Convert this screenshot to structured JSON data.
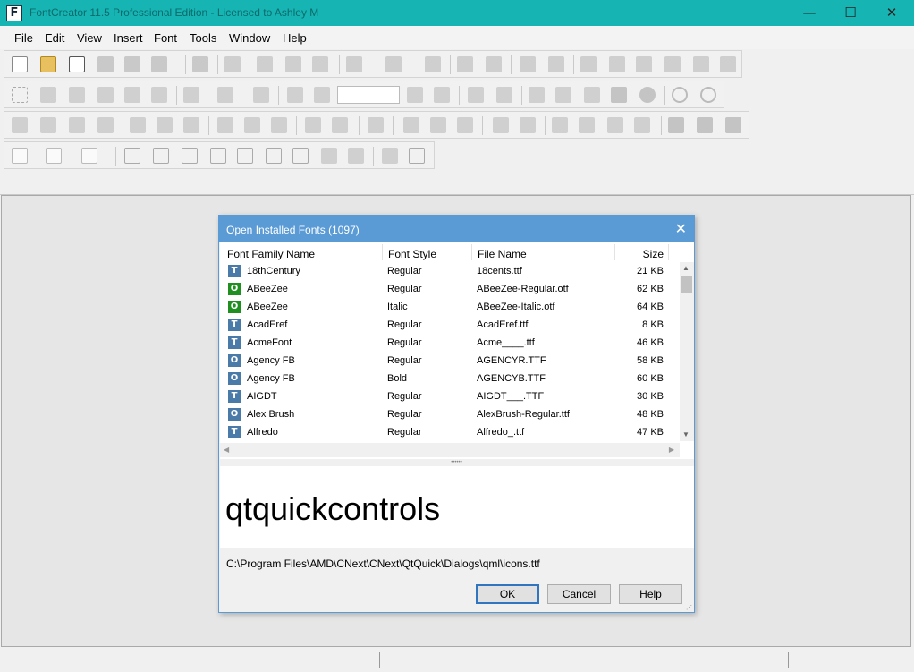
{
  "window": {
    "title": "FontCreator 11.5 Professional Edition - Licensed to Ashley M",
    "min_glyph": "—",
    "max_glyph": "☐",
    "close_glyph": "✕"
  },
  "menubar": {
    "items": [
      "File",
      "Edit",
      "View",
      "Insert",
      "Font",
      "Tools",
      "Window",
      "Help"
    ]
  },
  "toolbar": {
    "zoom_value": ""
  },
  "dialog": {
    "title": "Open Installed Fonts (1097)",
    "close_glyph": "✕",
    "columns": [
      "Font Family Name",
      "Font Style",
      "File Name",
      "Size"
    ],
    "rows": [
      {
        "type": "T",
        "name": "18thCentury",
        "style": "Regular",
        "file": "18cents.ttf",
        "size": "21 KB"
      },
      {
        "type": "O",
        "name": "ABeeZee",
        "style": "Regular",
        "file": "ABeeZee-Regular.otf",
        "size": "62 KB"
      },
      {
        "type": "O",
        "name": "ABeeZee",
        "style": "Italic",
        "file": "ABeeZee-Italic.otf",
        "size": "64 KB"
      },
      {
        "type": "T",
        "name": "AcadEref",
        "style": "Regular",
        "file": "AcadEref.ttf",
        "size": "8 KB"
      },
      {
        "type": "T",
        "name": "AcmeFont",
        "style": "Regular",
        "file": "Acme____.ttf",
        "size": "46 KB"
      },
      {
        "type": "O2",
        "name": "Agency FB",
        "style": "Regular",
        "file": "AGENCYR.TTF",
        "size": "58 KB"
      },
      {
        "type": "O2",
        "name": "Agency FB",
        "style": "Bold",
        "file": "AGENCYB.TTF",
        "size": "60 KB"
      },
      {
        "type": "T",
        "name": "AIGDT",
        "style": "Regular",
        "file": "AIGDT___.TTF",
        "size": "30 KB"
      },
      {
        "type": "O2",
        "name": "Alex Brush",
        "style": "Regular",
        "file": "AlexBrush-Regular.ttf",
        "size": "48 KB"
      },
      {
        "type": "T",
        "name": "Alfredo",
        "style": "Regular",
        "file": "Alfredo_.ttf",
        "size": "47 KB"
      }
    ],
    "preview_text": "qtquickcontrols",
    "path": "C:\\Program Files\\AMD\\CNext\\CNext\\QtQuick\\Dialogs\\qml\\icons.ttf",
    "buttons": {
      "ok": "OK",
      "cancel": "Cancel",
      "help": "Help"
    }
  },
  "scroll_glyphs": {
    "up": "▲",
    "down": "▼",
    "left": "◀",
    "right": "▶",
    "grip": "••••••"
  },
  "colors": {
    "titlebar": "#17b4b4",
    "dialog_title": "#5a9bd5",
    "truetype_icon": "#4a7aa8",
    "opentype_icon": "#1f8f1f",
    "selected_button_border": "#2f75c0"
  }
}
